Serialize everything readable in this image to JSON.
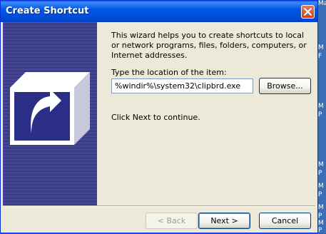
{
  "window": {
    "title": "Create Shortcut"
  },
  "description": "This wizard helps you to create shortcuts to local or network programs, files, folders, computers, or Internet addresses.",
  "location": {
    "label": "Type the location of the item:",
    "value": "%windir%\\system32\\clipbrd.exe"
  },
  "browse_label": "Browse...",
  "hint": "Click Next to continue.",
  "buttons": {
    "back": "< Back",
    "next": "Next >",
    "cancel": "Cancel"
  },
  "background_text": [
    "Management",
    "M",
    "F",
    "M",
    "P",
    "M",
    "P",
    "M",
    "P",
    "M",
    "P",
    "M",
    "P"
  ],
  "colors": {
    "titlebar": "#0058e6",
    "dialog_bg": "#ece9d8",
    "wizard_panel": "#3b3e94"
  },
  "icons": [
    "close-icon",
    "shortcut-arrow-icon"
  ]
}
